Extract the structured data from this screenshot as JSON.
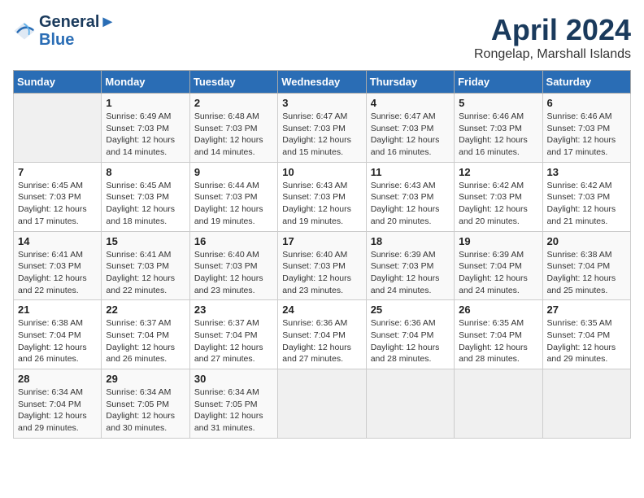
{
  "header": {
    "logo_line1": "General",
    "logo_line2": "Blue",
    "month_title": "April 2024",
    "subtitle": "Rongelap, Marshall Islands"
  },
  "days_of_week": [
    "Sunday",
    "Monday",
    "Tuesday",
    "Wednesday",
    "Thursday",
    "Friday",
    "Saturday"
  ],
  "weeks": [
    [
      {
        "day": "",
        "info": ""
      },
      {
        "day": "1",
        "info": "Sunrise: 6:49 AM\nSunset: 7:03 PM\nDaylight: 12 hours\nand 14 minutes."
      },
      {
        "day": "2",
        "info": "Sunrise: 6:48 AM\nSunset: 7:03 PM\nDaylight: 12 hours\nand 14 minutes."
      },
      {
        "day": "3",
        "info": "Sunrise: 6:47 AM\nSunset: 7:03 PM\nDaylight: 12 hours\nand 15 minutes."
      },
      {
        "day": "4",
        "info": "Sunrise: 6:47 AM\nSunset: 7:03 PM\nDaylight: 12 hours\nand 16 minutes."
      },
      {
        "day": "5",
        "info": "Sunrise: 6:46 AM\nSunset: 7:03 PM\nDaylight: 12 hours\nand 16 minutes."
      },
      {
        "day": "6",
        "info": "Sunrise: 6:46 AM\nSunset: 7:03 PM\nDaylight: 12 hours\nand 17 minutes."
      }
    ],
    [
      {
        "day": "7",
        "info": "Sunrise: 6:45 AM\nSunset: 7:03 PM\nDaylight: 12 hours\nand 17 minutes."
      },
      {
        "day": "8",
        "info": "Sunrise: 6:45 AM\nSunset: 7:03 PM\nDaylight: 12 hours\nand 18 minutes."
      },
      {
        "day": "9",
        "info": "Sunrise: 6:44 AM\nSunset: 7:03 PM\nDaylight: 12 hours\nand 19 minutes."
      },
      {
        "day": "10",
        "info": "Sunrise: 6:43 AM\nSunset: 7:03 PM\nDaylight: 12 hours\nand 19 minutes."
      },
      {
        "day": "11",
        "info": "Sunrise: 6:43 AM\nSunset: 7:03 PM\nDaylight: 12 hours\nand 20 minutes."
      },
      {
        "day": "12",
        "info": "Sunrise: 6:42 AM\nSunset: 7:03 PM\nDaylight: 12 hours\nand 20 minutes."
      },
      {
        "day": "13",
        "info": "Sunrise: 6:42 AM\nSunset: 7:03 PM\nDaylight: 12 hours\nand 21 minutes."
      }
    ],
    [
      {
        "day": "14",
        "info": "Sunrise: 6:41 AM\nSunset: 7:03 PM\nDaylight: 12 hours\nand 22 minutes."
      },
      {
        "day": "15",
        "info": "Sunrise: 6:41 AM\nSunset: 7:03 PM\nDaylight: 12 hours\nand 22 minutes."
      },
      {
        "day": "16",
        "info": "Sunrise: 6:40 AM\nSunset: 7:03 PM\nDaylight: 12 hours\nand 23 minutes."
      },
      {
        "day": "17",
        "info": "Sunrise: 6:40 AM\nSunset: 7:03 PM\nDaylight: 12 hours\nand 23 minutes."
      },
      {
        "day": "18",
        "info": "Sunrise: 6:39 AM\nSunset: 7:03 PM\nDaylight: 12 hours\nand 24 minutes."
      },
      {
        "day": "19",
        "info": "Sunrise: 6:39 AM\nSunset: 7:04 PM\nDaylight: 12 hours\nand 24 minutes."
      },
      {
        "day": "20",
        "info": "Sunrise: 6:38 AM\nSunset: 7:04 PM\nDaylight: 12 hours\nand 25 minutes."
      }
    ],
    [
      {
        "day": "21",
        "info": "Sunrise: 6:38 AM\nSunset: 7:04 PM\nDaylight: 12 hours\nand 26 minutes."
      },
      {
        "day": "22",
        "info": "Sunrise: 6:37 AM\nSunset: 7:04 PM\nDaylight: 12 hours\nand 26 minutes."
      },
      {
        "day": "23",
        "info": "Sunrise: 6:37 AM\nSunset: 7:04 PM\nDaylight: 12 hours\nand 27 minutes."
      },
      {
        "day": "24",
        "info": "Sunrise: 6:36 AM\nSunset: 7:04 PM\nDaylight: 12 hours\nand 27 minutes."
      },
      {
        "day": "25",
        "info": "Sunrise: 6:36 AM\nSunset: 7:04 PM\nDaylight: 12 hours\nand 28 minutes."
      },
      {
        "day": "26",
        "info": "Sunrise: 6:35 AM\nSunset: 7:04 PM\nDaylight: 12 hours\nand 28 minutes."
      },
      {
        "day": "27",
        "info": "Sunrise: 6:35 AM\nSunset: 7:04 PM\nDaylight: 12 hours\nand 29 minutes."
      }
    ],
    [
      {
        "day": "28",
        "info": "Sunrise: 6:34 AM\nSunset: 7:04 PM\nDaylight: 12 hours\nand 29 minutes."
      },
      {
        "day": "29",
        "info": "Sunrise: 6:34 AM\nSunset: 7:05 PM\nDaylight: 12 hours\nand 30 minutes."
      },
      {
        "day": "30",
        "info": "Sunrise: 6:34 AM\nSunset: 7:05 PM\nDaylight: 12 hours\nand 31 minutes."
      },
      {
        "day": "",
        "info": ""
      },
      {
        "day": "",
        "info": ""
      },
      {
        "day": "",
        "info": ""
      },
      {
        "day": "",
        "info": ""
      }
    ]
  ]
}
